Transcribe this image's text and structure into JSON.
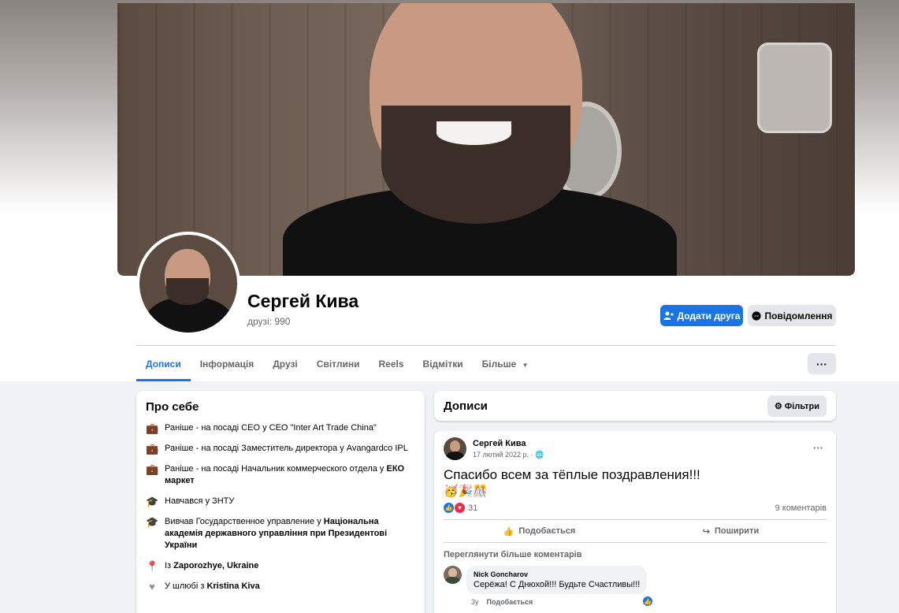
{
  "profile": {
    "name": "Сергей Кива",
    "friends": "друзі: 990"
  },
  "buttons": {
    "add_friend": "Додати друга",
    "message": "Повідомлення",
    "more": "···"
  },
  "tabs": [
    {
      "label": "Дописи",
      "active": true
    },
    {
      "label": "Інформація"
    },
    {
      "label": "Друзі"
    },
    {
      "label": "Світлини"
    },
    {
      "label": "Reels"
    },
    {
      "label": "Відмітки"
    },
    {
      "label": "Більше"
    }
  ],
  "intro": {
    "title": "Про себе",
    "items": [
      {
        "icon": "briefcase-icon",
        "text": "Раніше - на посаді CEO у CEO \"Inter Art Trade China\""
      },
      {
        "icon": "briefcase-icon",
        "text": "Раніше - на посаді Заместитель директора у Avangardco IPL"
      },
      {
        "icon": "briefcase-icon",
        "prefix": "Раніше - на посаді Начальник коммерческого отдела у ",
        "bold": "ЕКО маркет"
      },
      {
        "icon": "graduation-cap-icon",
        "text": "Навчався у ЗНТУ"
      },
      {
        "icon": "graduation-cap-icon",
        "prefix": "Вивчав Государственное управление у ",
        "bold": "Національна академія державного управління при Президентові України"
      },
      {
        "icon": "location-pin-icon",
        "prefix": "Із ",
        "bold": "Zaporozhye, Ukraine"
      },
      {
        "icon": "heart-icon",
        "prefix": "У шлюбі з ",
        "bold": "Kristina Kiva"
      }
    ]
  },
  "posts_header": {
    "title": "Дописи",
    "filter_label": "Фільтри"
  },
  "post": {
    "author": "Сергей Кива",
    "date": "17 лютий 2022 р. · ",
    "text": "Спасибо всем за тёплые поздравления!!!",
    "emoji": "🥳🎉🎊",
    "reaction_count": "31",
    "comment_count": "9 коментарів",
    "like_label": "Подобається",
    "share_label": "Поширити",
    "view_more": "Переглянути більше коментарів",
    "comment": {
      "author": "Nick Goncharov",
      "text": "Серёжа! С Днюхой!!! Будьте Счастливы!!!",
      "age": "3у",
      "like_label": "Подобається"
    }
  },
  "colors": {
    "primary": "#1b74e4",
    "background": "#f0f2f5",
    "secondary_text": "#65676b"
  }
}
